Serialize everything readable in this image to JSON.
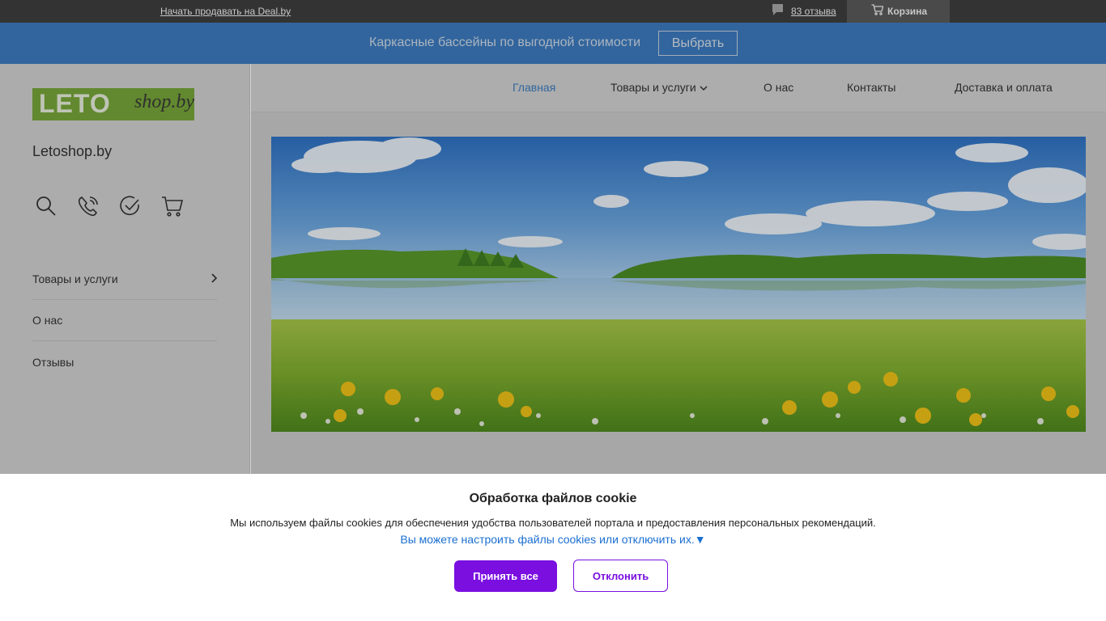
{
  "topbar": {
    "sell_link": "Начать продавать на Deal.by",
    "reviews": "83 отзыва",
    "cart": "Корзина",
    "reviews_icon": "chat-bubble-icon",
    "cart_icon": "cart-icon"
  },
  "promo": {
    "text": "Каркасные бассейны по выгодной стоимости",
    "button": "Выбрать"
  },
  "logo": {
    "part1": "LETO",
    "part2": "shop.by"
  },
  "sidebar": {
    "site_name": "Letoshop.by",
    "icons": [
      "search-icon",
      "phone-icon",
      "check-circle-icon",
      "cart-icon"
    ],
    "items": [
      {
        "label": "Товары и услуги"
      },
      {
        "label": "О нас"
      },
      {
        "label": "Отзывы"
      }
    ]
  },
  "menu": {
    "items": [
      {
        "label": "Главная"
      },
      {
        "label": "Товары и услуги"
      },
      {
        "label": "О нас"
      },
      {
        "label": "Контакты"
      },
      {
        "label": "Доставка и оплата"
      }
    ]
  },
  "cookie": {
    "title": "Обработка файлов cookie",
    "text": "Мы используем файлы cookies для обеспечения удобства пользователей портала и предоставления персональных рекомендаций.",
    "link": "Вы можете настроить файлы cookies или отключить их.▼",
    "accept": "Принять все",
    "decline": "Отклонить"
  },
  "colors": {
    "topbar": "#333333",
    "promo": "#3d7cc0",
    "accent": "#7a0fe0",
    "link": "#1a6fd1",
    "menu_active": "#3d7cc0"
  }
}
